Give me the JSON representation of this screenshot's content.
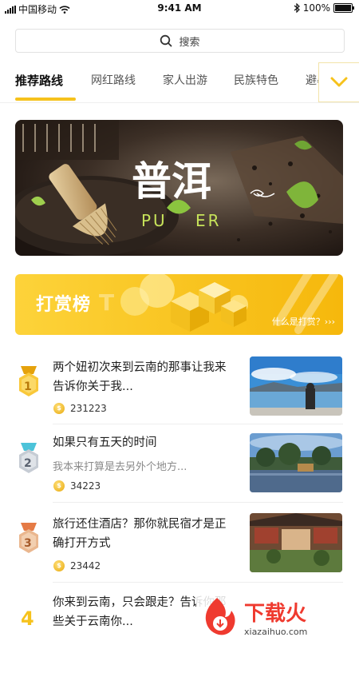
{
  "status_bar": {
    "carrier": "中国移动",
    "time": "9:41 AM",
    "battery": "100%"
  },
  "search": {
    "label": "搜索",
    "icon": "search-icon"
  },
  "tabs": [
    {
      "label": "推荐路线",
      "active": true
    },
    {
      "label": "网红路线",
      "active": false
    },
    {
      "label": "家人出游",
      "active": false
    },
    {
      "label": "民族特色",
      "active": false
    },
    {
      "label": "避暑",
      "active": false
    }
  ],
  "banner": {
    "title": "普洱",
    "pinyin_left": "PU",
    "pinyin_right": "ER"
  },
  "reward": {
    "title": "打赏榜",
    "link": "什么是打赏？›››"
  },
  "list": [
    {
      "rank": "1",
      "title": "两个妞初次来到云南的那事让我来告诉你关于我...",
      "subtitle": "",
      "count": "231223"
    },
    {
      "rank": "2",
      "title": "如果只有五天的时间",
      "subtitle": "我本来打算是去另外个地方...",
      "count": "34223"
    },
    {
      "rank": "3",
      "title": "旅行还住酒店？那你就民宿才是正确打开方式",
      "subtitle": "",
      "count": "23442"
    },
    {
      "rank": "4",
      "title": "你来到云南，只会跟走？告诉你那些关于云南你...",
      "subtitle": "",
      "count": ""
    }
  ],
  "watermark": {
    "brand": "下载火",
    "url": "xiazaihuo.com"
  },
  "colors": {
    "accent": "#f6c21c",
    "gold": "#e8a90c"
  }
}
